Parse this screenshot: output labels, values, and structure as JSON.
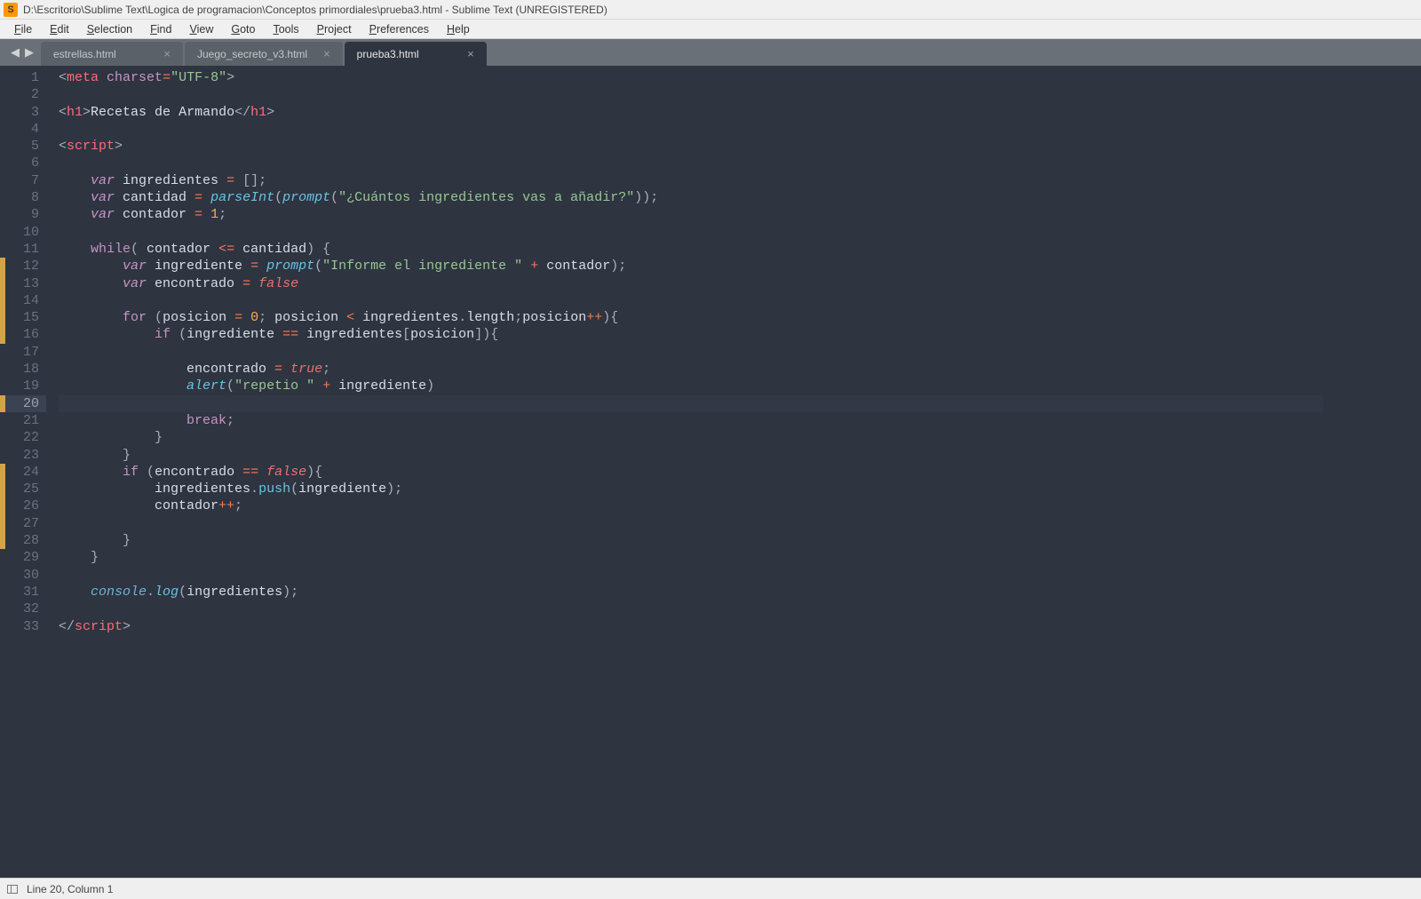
{
  "title": "D:\\Escritorio\\Sublime Text\\Logica de programacion\\Conceptos primordiales\\prueba3.html - Sublime Text (UNREGISTERED)",
  "menu": [
    "File",
    "Edit",
    "Selection",
    "Find",
    "View",
    "Goto",
    "Tools",
    "Project",
    "Preferences",
    "Help"
  ],
  "tabs": [
    {
      "label": "estrellas.html",
      "active": false
    },
    {
      "label": "Juego_secreto_v3.html",
      "active": false
    },
    {
      "label": "prueba3.html",
      "active": true
    }
  ],
  "status": {
    "cursor": "Line 20, Column 1"
  },
  "editor": {
    "current_line": 20,
    "modified_ranges": [
      [
        12,
        16
      ],
      [
        20,
        20
      ],
      [
        24,
        28
      ]
    ],
    "lines": [
      {
        "n": 1,
        "t": [
          [
            "pun",
            "<"
          ],
          [
            "tag",
            "meta"
          ],
          [
            "name",
            " "
          ],
          [
            "attr",
            "charset"
          ],
          [
            "op",
            "="
          ],
          [
            "str",
            "\"UTF-8\""
          ],
          [
            "pun",
            ">"
          ]
        ]
      },
      {
        "n": 2,
        "t": []
      },
      {
        "n": 3,
        "t": [
          [
            "pun",
            "<"
          ],
          [
            "tag",
            "h1"
          ],
          [
            "pun",
            ">"
          ],
          [
            "name",
            "Recetas de Armando"
          ],
          [
            "pun",
            "</"
          ],
          [
            "tag",
            "h1"
          ],
          [
            "pun",
            ">"
          ]
        ]
      },
      {
        "n": 4,
        "t": []
      },
      {
        "n": 5,
        "t": [
          [
            "pun",
            "<"
          ],
          [
            "tag",
            "script"
          ],
          [
            "pun",
            ">"
          ]
        ]
      },
      {
        "n": 6,
        "t": []
      },
      {
        "n": 7,
        "t": [
          [
            "name",
            "    "
          ],
          [
            "kw",
            "var"
          ],
          [
            "name",
            " ingredientes "
          ],
          [
            "op",
            "="
          ],
          [
            "name",
            " "
          ],
          [
            "pun",
            "[]"
          ],
          [
            "pun",
            ";"
          ]
        ]
      },
      {
        "n": 8,
        "t": [
          [
            "name",
            "    "
          ],
          [
            "kw",
            "var"
          ],
          [
            "name",
            " cantidad "
          ],
          [
            "op",
            "="
          ],
          [
            "name",
            " "
          ],
          [
            "fn-i",
            "parseInt"
          ],
          [
            "pun",
            "("
          ],
          [
            "fn-i",
            "prompt"
          ],
          [
            "pun",
            "("
          ],
          [
            "str",
            "\"¿Cuántos ingredientes vas a añadir?\""
          ],
          [
            "pun",
            "))"
          ],
          [
            "pun",
            ";"
          ]
        ]
      },
      {
        "n": 9,
        "t": [
          [
            "name",
            "    "
          ],
          [
            "kw",
            "var"
          ],
          [
            "name",
            " contador "
          ],
          [
            "op",
            "="
          ],
          [
            "name",
            " "
          ],
          [
            "num",
            "1"
          ],
          [
            "pun",
            ";"
          ]
        ]
      },
      {
        "n": 10,
        "t": []
      },
      {
        "n": 11,
        "t": [
          [
            "name",
            "    "
          ],
          [
            "kw2",
            "while"
          ],
          [
            "pun",
            "("
          ],
          [
            "name",
            " contador "
          ],
          [
            "op",
            "<="
          ],
          [
            "name",
            " cantidad"
          ],
          [
            "pun",
            ")"
          ],
          [
            "name",
            " "
          ],
          [
            "pun",
            "{"
          ]
        ]
      },
      {
        "n": 12,
        "t": [
          [
            "name",
            "        "
          ],
          [
            "kw",
            "var"
          ],
          [
            "name",
            " ingrediente "
          ],
          [
            "op",
            "="
          ],
          [
            "name",
            " "
          ],
          [
            "fn-i",
            "prompt"
          ],
          [
            "pun",
            "("
          ],
          [
            "str",
            "\"Informe el ingrediente \""
          ],
          [
            "name",
            " "
          ],
          [
            "op",
            "+"
          ],
          [
            "name",
            " contador"
          ],
          [
            "pun",
            ")"
          ],
          [
            "pun",
            ";"
          ]
        ]
      },
      {
        "n": 13,
        "t": [
          [
            "name",
            "        "
          ],
          [
            "kw",
            "var"
          ],
          [
            "name",
            " encontrado "
          ],
          [
            "op",
            "="
          ],
          [
            "name",
            " "
          ],
          [
            "boolr",
            "false"
          ]
        ]
      },
      {
        "n": 14,
        "t": []
      },
      {
        "n": 15,
        "t": [
          [
            "name",
            "        "
          ],
          [
            "kw2",
            "for"
          ],
          [
            "name",
            " "
          ],
          [
            "pun",
            "("
          ],
          [
            "name",
            "posicion "
          ],
          [
            "op",
            "="
          ],
          [
            "name",
            " "
          ],
          [
            "num",
            "0"
          ],
          [
            "pun",
            ";"
          ],
          [
            "name",
            " posicion "
          ],
          [
            "op",
            "<"
          ],
          [
            "name",
            " ingredientes"
          ],
          [
            "dot",
            "."
          ],
          [
            "name",
            "length"
          ],
          [
            "pun",
            ";"
          ],
          [
            "name",
            "posicion"
          ],
          [
            "op",
            "++"
          ],
          [
            "pun",
            ")"
          ],
          [
            "pun",
            "{"
          ]
        ]
      },
      {
        "n": 16,
        "t": [
          [
            "name",
            "            "
          ],
          [
            "kw2",
            "if"
          ],
          [
            "name",
            " "
          ],
          [
            "pun",
            "("
          ],
          [
            "name",
            "ingrediente "
          ],
          [
            "op",
            "=="
          ],
          [
            "name",
            " ingredientes"
          ],
          [
            "pun",
            "["
          ],
          [
            "name",
            "posicion"
          ],
          [
            "pun",
            "]"
          ],
          [
            "pun",
            ")"
          ],
          [
            "pun",
            "{"
          ]
        ]
      },
      {
        "n": 17,
        "t": []
      },
      {
        "n": 18,
        "t": [
          [
            "name",
            "                encontrado "
          ],
          [
            "op",
            "="
          ],
          [
            "name",
            " "
          ],
          [
            "boolr",
            "true"
          ],
          [
            "pun",
            ";"
          ]
        ]
      },
      {
        "n": 19,
        "t": [
          [
            "name",
            "                "
          ],
          [
            "fn-i",
            "alert"
          ],
          [
            "pun",
            "("
          ],
          [
            "str",
            "\"repetio \""
          ],
          [
            "name",
            " "
          ],
          [
            "op",
            "+"
          ],
          [
            "name",
            " ingrediente"
          ],
          [
            "pun",
            ")"
          ]
        ]
      },
      {
        "n": 20,
        "t": []
      },
      {
        "n": 21,
        "t": [
          [
            "name",
            "                "
          ],
          [
            "kw2",
            "break"
          ],
          [
            "pun",
            ";"
          ]
        ]
      },
      {
        "n": 22,
        "t": [
          [
            "name",
            "            "
          ],
          [
            "pun",
            "}"
          ]
        ]
      },
      {
        "n": 23,
        "t": [
          [
            "name",
            "        "
          ],
          [
            "pun",
            "}"
          ]
        ]
      },
      {
        "n": 24,
        "t": [
          [
            "name",
            "        "
          ],
          [
            "kw2",
            "if"
          ],
          [
            "name",
            " "
          ],
          [
            "pun",
            "("
          ],
          [
            "name",
            "encontrado "
          ],
          [
            "op",
            "=="
          ],
          [
            "name",
            " "
          ],
          [
            "boolr",
            "false"
          ],
          [
            "pun",
            ")"
          ],
          [
            "pun",
            "{"
          ]
        ]
      },
      {
        "n": 25,
        "t": [
          [
            "name",
            "            ingredientes"
          ],
          [
            "dot",
            "."
          ],
          [
            "fn",
            "push"
          ],
          [
            "pun",
            "("
          ],
          [
            "name",
            "ingrediente"
          ],
          [
            "pun",
            ")"
          ],
          [
            "pun",
            ";"
          ]
        ]
      },
      {
        "n": 26,
        "t": [
          [
            "name",
            "            contador"
          ],
          [
            "op",
            "++"
          ],
          [
            "pun",
            ";"
          ]
        ]
      },
      {
        "n": 27,
        "t": []
      },
      {
        "n": 28,
        "t": [
          [
            "name",
            "        "
          ],
          [
            "pun",
            "}"
          ]
        ]
      },
      {
        "n": 29,
        "t": [
          [
            "name",
            "    "
          ],
          [
            "pun",
            "}"
          ]
        ]
      },
      {
        "n": 30,
        "t": []
      },
      {
        "n": 31,
        "t": [
          [
            "name",
            "    "
          ],
          [
            "obj",
            "console"
          ],
          [
            "dot",
            "."
          ],
          [
            "fn-i",
            "log"
          ],
          [
            "pun",
            "("
          ],
          [
            "name",
            "ingredientes"
          ],
          [
            "pun",
            ")"
          ],
          [
            "pun",
            ";"
          ]
        ]
      },
      {
        "n": 32,
        "t": []
      },
      {
        "n": 33,
        "t": [
          [
            "pun",
            "</"
          ],
          [
            "tag",
            "script"
          ],
          [
            "pun",
            ">"
          ]
        ]
      }
    ]
  }
}
